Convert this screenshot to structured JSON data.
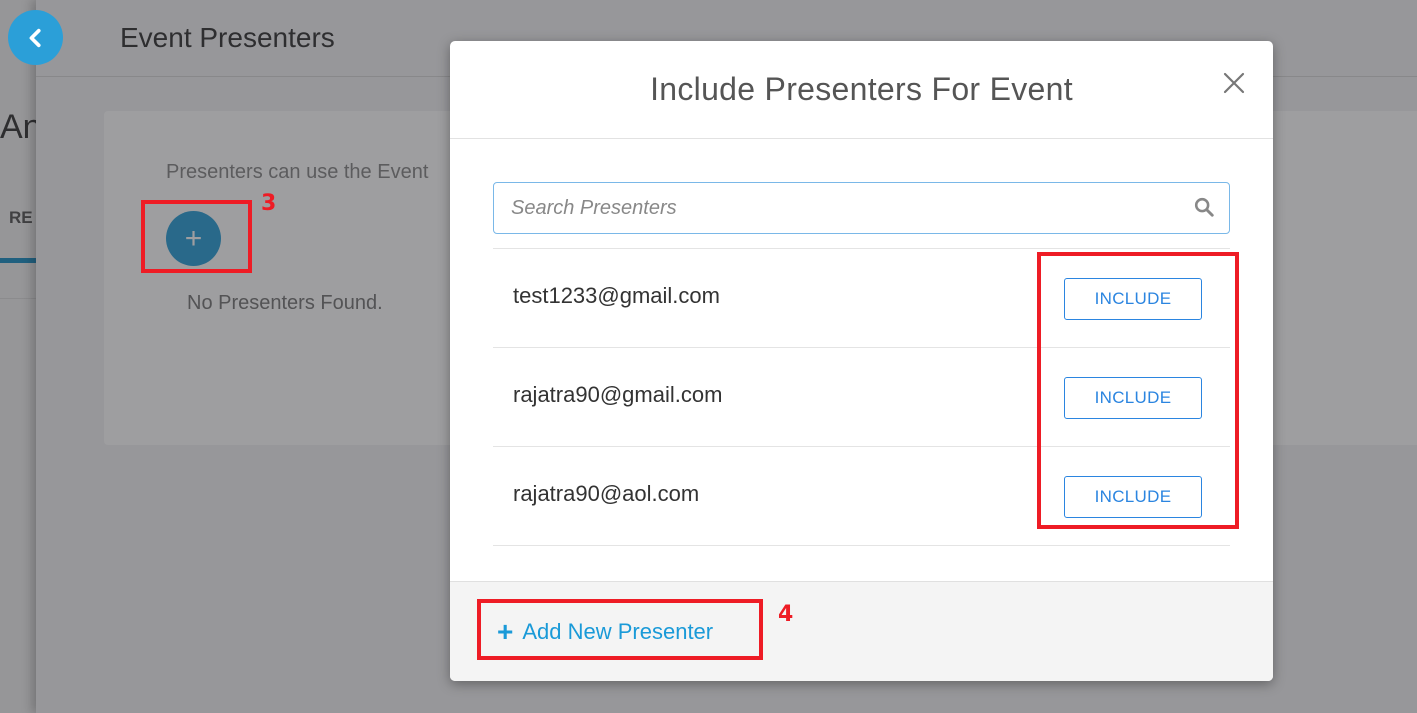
{
  "background_page": {
    "left_panel": {
      "title_fragment": "An",
      "tab_fragment": "RE"
    },
    "drawer": {
      "title": "Event Presenters",
      "back_button_icon": "chevron-left-icon",
      "description": "Presenters can use the Event",
      "add_button_icon": "plus-icon",
      "add_button_glyph": "+",
      "empty_message": "No Presenters Found."
    }
  },
  "modal": {
    "title": "Include Presenters For Event",
    "close_icon": "close-icon",
    "search": {
      "placeholder": "Search Presenters",
      "value": "",
      "icon": "search-icon"
    },
    "presenters": [
      {
        "email": "test1233@gmail.com",
        "action_label": "INCLUDE"
      },
      {
        "email": "rajatra90@gmail.com",
        "action_label": "INCLUDE"
      },
      {
        "email": "rajatra90@aol.com",
        "action_label": "INCLUDE"
      }
    ],
    "footer": {
      "add_new_glyph": "+",
      "add_new_label": "Add New Presenter"
    }
  },
  "annotations": [
    {
      "number": "3",
      "target": "add-presenter-circle-button"
    },
    {
      "number": "4",
      "target": "add-new-presenter-link"
    },
    {
      "number": "",
      "target": "include-buttons"
    }
  ],
  "colors": {
    "accent_blue": "#2b9fd8",
    "button_blue": "#2b85e0",
    "link_blue": "#1a9ad8",
    "annotation_red": "#ee1c25"
  }
}
